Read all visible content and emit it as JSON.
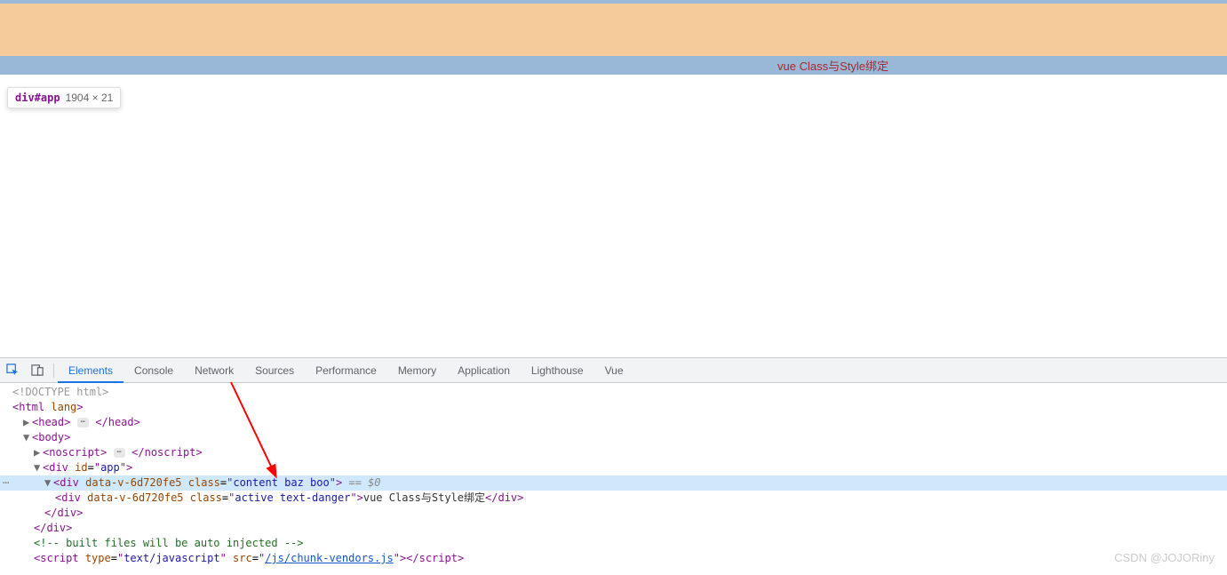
{
  "page": {
    "blue_bar_text": "vue Class与Style绑定"
  },
  "tooltip": {
    "selector": "div#app",
    "dimensions": "1904 × 21"
  },
  "devtools": {
    "tabs": [
      "Elements",
      "Console",
      "Network",
      "Sources",
      "Performance",
      "Memory",
      "Application",
      "Lighthouse",
      "Vue"
    ],
    "active_tab": "Elements"
  },
  "dom": {
    "doctype": "<!DOCTYPE html>",
    "html_open": "html",
    "html_lang_attr": "lang",
    "head_tag": "head",
    "body_tag": "body",
    "noscript_tag": "noscript",
    "div_tag": "div",
    "app_id_attr": "id",
    "app_id_val": "app",
    "data_v_attr": "data-v-6d720fe5",
    "class_attr": "class",
    "content_class_val": "content baz boo",
    "eq0": " == $0",
    "active_class_val": "active text-danger",
    "inner_text": "vue Class与Style绑定",
    "close_div1": "div",
    "close_div2": "div",
    "comment_text": " built files will be auto injected ",
    "script_tag": "script",
    "script_type_attr": "type",
    "script_type_val": "text/javascript",
    "script_src_attr": "src",
    "script_src_val": "/js/chunk-vendors.js"
  },
  "watermark": "CSDN @JOJORiny"
}
